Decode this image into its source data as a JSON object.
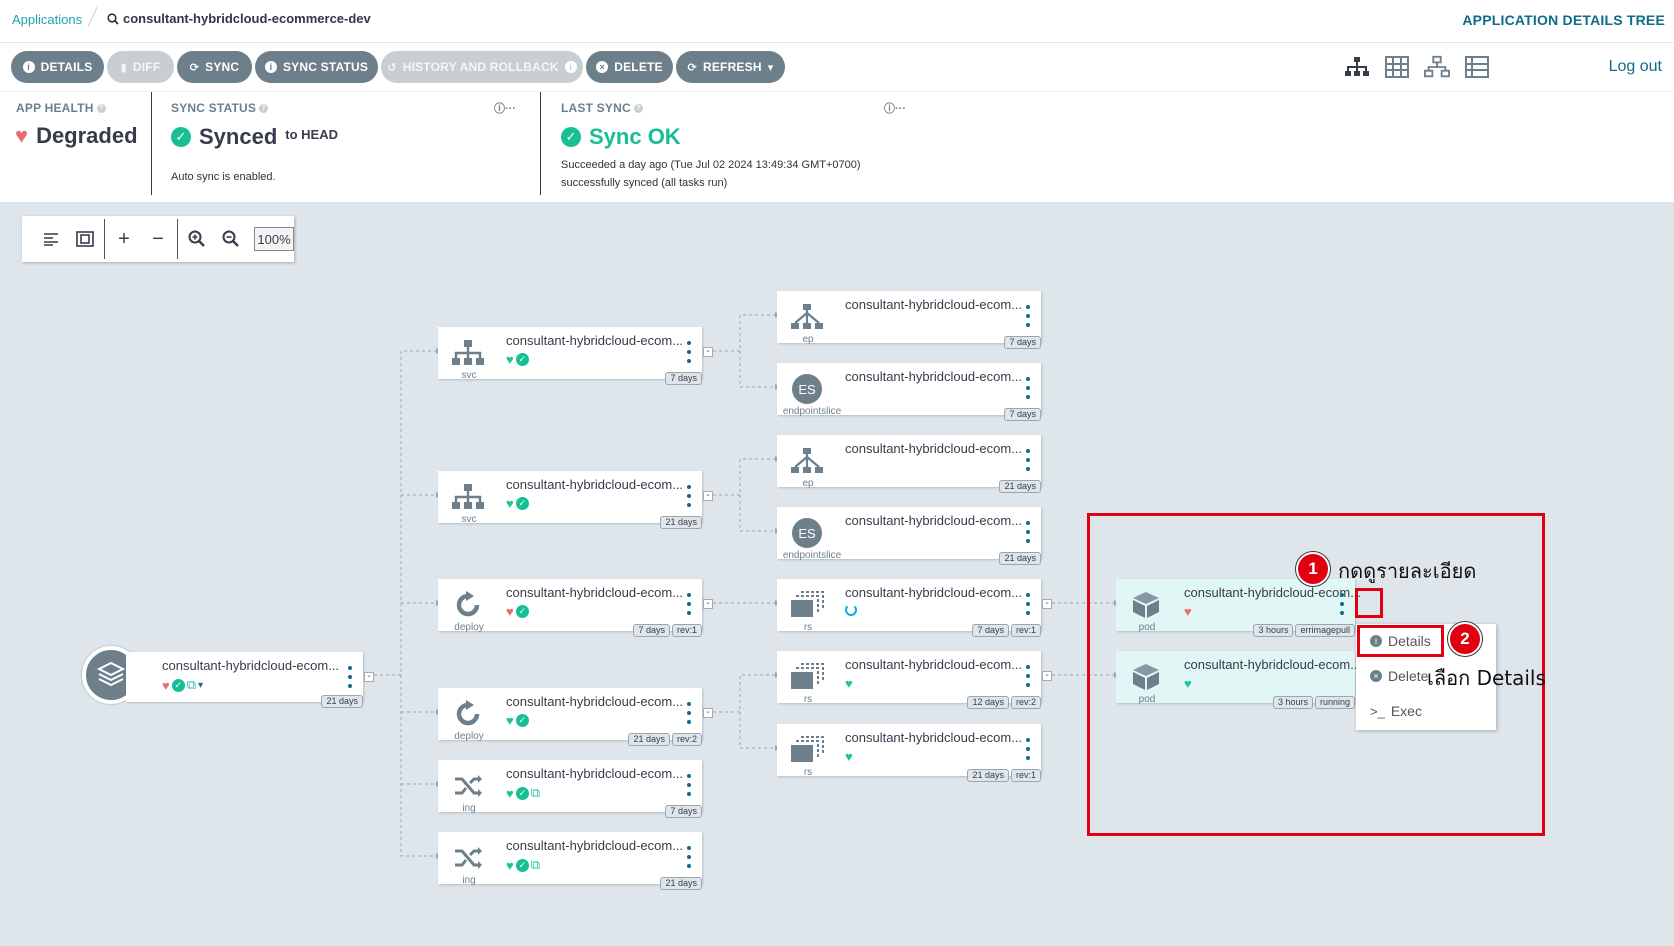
{
  "header": {
    "breadcrumb_app": "Applications",
    "breadcrumb_current": "consultant-hybridcloud-ecommerce-dev",
    "page_title": "APPLICATION DETAILS TREE",
    "logout": "Log out"
  },
  "toolbar": {
    "details": "DETAILS",
    "diff": "DIFF",
    "sync": "SYNC",
    "sync_status": "SYNC STATUS",
    "history": "HISTORY AND ROLLBACK",
    "delete": "DELETE",
    "refresh": "REFRESH"
  },
  "status": {
    "app_health_label": "APP HEALTH",
    "app_health_value": "Degraded",
    "sync_status_label": "SYNC STATUS",
    "sync_status_value": "Synced",
    "sync_to": "to HEAD",
    "auto_sync": "Auto sync is enabled.",
    "last_sync_label": "LAST SYNC",
    "last_sync_value": "Sync OK",
    "last_sync_time": "Succeeded a day ago (Tue Jul 02 2024 13:49:34 GMT+0700)",
    "last_sync_msg": "successfully synced (all tasks run)"
  },
  "zoom": {
    "level": "100%"
  },
  "nodes": {
    "root": {
      "title": "consultant-hybridcloud-ecom...",
      "age": "21 days"
    },
    "svc1": {
      "title": "consultant-hybridcloud-ecom...",
      "kind": "svc",
      "age": "7 days"
    },
    "svc2": {
      "title": "consultant-hybridcloud-ecom...",
      "kind": "svc",
      "age": "21 days"
    },
    "deploy1": {
      "title": "consultant-hybridcloud-ecom...",
      "kind": "deploy",
      "age": "7 days",
      "rev": "rev:1"
    },
    "deploy2": {
      "title": "consultant-hybridcloud-ecom...",
      "kind": "deploy",
      "age": "21 days",
      "rev": "rev:2"
    },
    "ing1": {
      "title": "consultant-hybridcloud-ecom...",
      "kind": "ing",
      "age": "7 days"
    },
    "ing2": {
      "title": "consultant-hybridcloud-ecom...",
      "kind": "ing",
      "age": "21 days"
    },
    "ep1": {
      "title": "consultant-hybridcloud-ecom...",
      "kind": "ep",
      "age": "7 days"
    },
    "es1": {
      "title": "consultant-hybridcloud-ecom...",
      "kind": "endpointslice",
      "icon_text": "ES",
      "age": "7 days"
    },
    "ep2": {
      "title": "consultant-hybridcloud-ecom...",
      "kind": "ep",
      "age": "21 days"
    },
    "es2": {
      "title": "consultant-hybridcloud-ecom...",
      "kind": "endpointslice",
      "icon_text": "ES",
      "age": "21 days"
    },
    "rs1": {
      "title": "consultant-hybridcloud-ecom...",
      "kind": "rs",
      "age": "7 days",
      "rev": "rev:1"
    },
    "rs2": {
      "title": "consultant-hybridcloud-ecom...",
      "kind": "rs",
      "age": "12 days",
      "rev": "rev:2"
    },
    "rs3": {
      "title": "consultant-hybridcloud-ecom...",
      "kind": "rs",
      "age": "21 days",
      "rev": "rev:1"
    },
    "pod1": {
      "title": "consultant-hybridcloud-ecom...",
      "kind": "pod",
      "age": "3 hours",
      "state": "errimagepull"
    },
    "pod2": {
      "title": "consultant-hybridcloud-ecom...",
      "kind": "pod",
      "age": "3 hours",
      "state": "running"
    }
  },
  "context_menu": {
    "details": "Details",
    "delete": "Delete",
    "exec": "Exec"
  },
  "annotations": {
    "step1_num": "1",
    "step1_text": "กดดูรายละเอียด",
    "step2_num": "2",
    "step2_text": "เลือก Details"
  },
  "colors": {
    "accent": "#0f6b8a",
    "healthy": "#1ec2a1",
    "degraded": "#e96d76",
    "synced": "#18be94",
    "annotation": "#e00012"
  }
}
